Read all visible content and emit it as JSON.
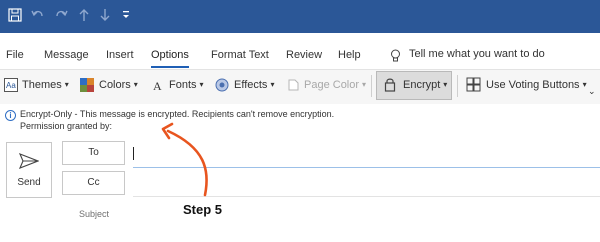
{
  "quick_access": {
    "icons": [
      "save-icon",
      "undo-icon",
      "redo-icon",
      "up-arrow-icon",
      "down-arrow-icon",
      "customize-icon"
    ],
    "bar_color": "#2b5797"
  },
  "menu": {
    "tabs": [
      "File",
      "Message",
      "Insert",
      "Options",
      "Format Text",
      "Review",
      "Help"
    ],
    "active_tab": "Options",
    "tell_me": "Tell me what you want to do"
  },
  "ribbon": {
    "themes": "Themes",
    "colors": "Colors",
    "fonts": "Fonts",
    "effects": "Effects",
    "page_color": "Page Color",
    "encrypt": "Encrypt",
    "voting": "Use Voting Buttons"
  },
  "info_bar": {
    "line1": "Encrypt-Only - This message is encrypted. Recipients can't remove encryption.",
    "line2": "Permission granted by:"
  },
  "compose": {
    "send": "Send",
    "to": "To",
    "cc": "Cc",
    "subject": "Subject"
  },
  "annotation": {
    "step": "Step 5",
    "color": "#e8551f"
  }
}
